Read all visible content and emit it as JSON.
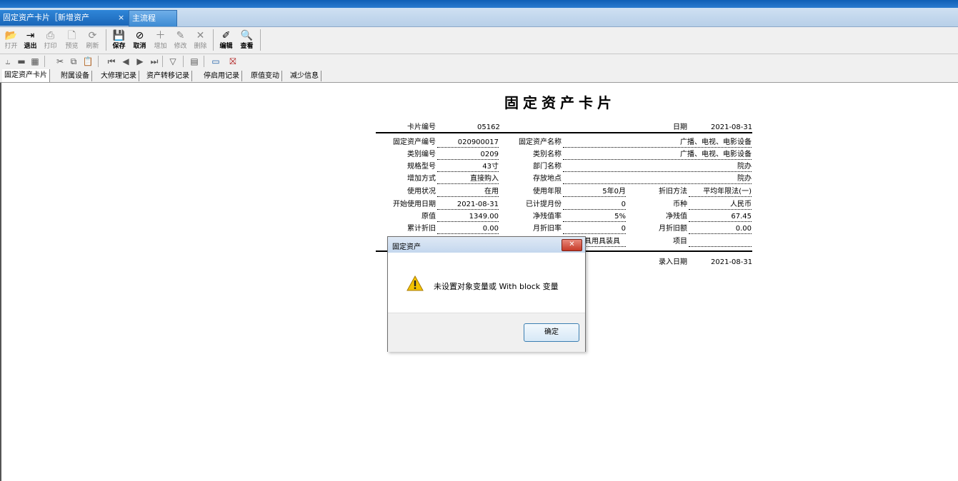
{
  "window": {
    "tabs": [
      {
        "label": "固定资产卡片［新增资产",
        "close": "×"
      },
      {
        "label": "主流程"
      }
    ]
  },
  "toolbar": {
    "buttons": [
      {
        "label": "打开",
        "icon": "folder-open-icon",
        "glyph": "📂",
        "enabled": false
      },
      {
        "label": "退出",
        "icon": "exit-icon",
        "glyph": "⇥",
        "enabled": true
      },
      {
        "label": "打印",
        "icon": "print-icon",
        "glyph": "⎙",
        "enabled": false
      },
      {
        "label": "预览",
        "icon": "preview-icon",
        "glyph": "🗋",
        "enabled": false
      },
      {
        "label": "刷新",
        "icon": "refresh-icon",
        "glyph": "⟳",
        "enabled": false
      },
      {
        "label": "保存",
        "icon": "save-icon",
        "glyph": "💾",
        "enabled": true
      },
      {
        "label": "取消",
        "icon": "cancel-icon",
        "glyph": "⊘",
        "enabled": true
      },
      {
        "label": "增加",
        "icon": "add-icon",
        "glyph": "＋",
        "enabled": false
      },
      {
        "label": "修改",
        "icon": "edit-icon",
        "glyph": "✎",
        "enabled": false
      },
      {
        "label": "删除",
        "icon": "delete-icon",
        "glyph": "✕",
        "enabled": false
      },
      {
        "label": "编辑",
        "icon": "edit-card-icon",
        "glyph": "✐",
        "enabled": true
      },
      {
        "label": "查看",
        "icon": "view-icon",
        "glyph": "🔍",
        "enabled": true
      }
    ]
  },
  "toolbar2": {
    "icons": [
      "filter-funnel-icon",
      "card-icon",
      "columns-icon",
      "cut-icon",
      "copy-icon",
      "paste-icon",
      "first-record-icon",
      "prev-record-icon",
      "next-record-icon",
      "last-record-icon",
      "filter-icon",
      "grid-icon",
      "display-icon",
      "flag-icon"
    ]
  },
  "subtabs": [
    "固定资产卡片",
    "附属设备",
    "大修理记录",
    "资产转移记录",
    "停启用记录",
    "原值变动",
    "减少信息"
  ],
  "card": {
    "title": "固定资产卡片",
    "card_no_label": "卡片编号",
    "card_no": "05162",
    "date_label": "日期",
    "date": "2021-08-31",
    "asset_code_label": "固定资产编号",
    "asset_code": "020900017",
    "asset_name_label": "固定资产名称",
    "asset_name": "广播、电视、电影设备",
    "category_code_label": "类别编号",
    "category_code": "0209",
    "category_name_label": "类别名称",
    "category_name": "广播、电视、电影设备",
    "model_label": "规格型号",
    "model": "43寸",
    "dept_label": "部门名称",
    "dept": "院办",
    "add_method_label": "增加方式",
    "add_method": "直接购入",
    "location_label": "存放地点",
    "location": "院办",
    "status_label": "使用状况",
    "status": "在用",
    "life_label": "使用年限",
    "life": "5年0月",
    "dep_method_label": "折旧方法",
    "dep_method": "平均年限法(一)",
    "start_date_label": "开始使用日期",
    "start_date": "2021-08-31",
    "months_label": "已计提月份",
    "months": "0",
    "currency_label": "币种",
    "currency": "人民币",
    "orig_value_label": "原值",
    "orig_value": "1349.00",
    "residual_rate_label": "净残值率",
    "residual_rate": "5%",
    "residual_label": "净残值",
    "residual": "67.45",
    "acc_dep_label": "累计折旧",
    "acc_dep": "0.00",
    "month_rate_label": "月折旧率",
    "month_rate": "0",
    "month_dep_label": "月折旧额",
    "month_dep": "0.00",
    "partial_text": "具用具装具",
    "project_label": "项目",
    "project": "",
    "entry_date_label": "录入日期",
    "entry_date": "2021-08-31"
  },
  "dialog": {
    "title": "固定资产",
    "close": "✕",
    "message": "未设置对象变量或 With block 变量",
    "ok": "确定"
  }
}
